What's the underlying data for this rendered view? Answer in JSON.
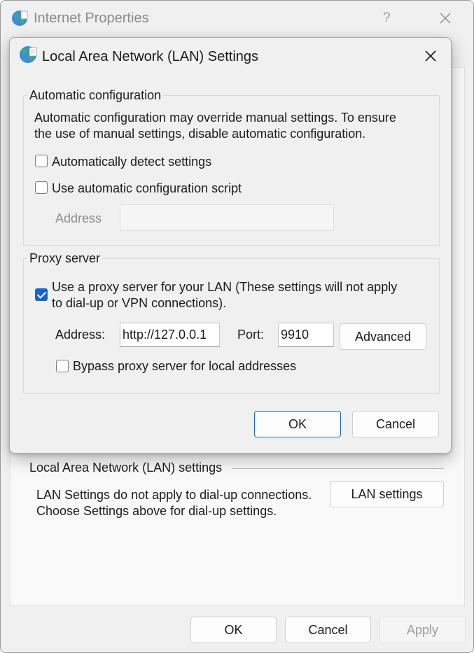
{
  "parent_window": {
    "title": "Internet Properties",
    "help": "?",
    "lan_group_title": "Local Area Network (LAN) settings",
    "lan_description": "LAN Settings do not apply to dial-up connections. Choose Settings above for dial-up settings.",
    "lan_settings_button": "LAN settings",
    "buttons": {
      "ok": "OK",
      "cancel": "Cancel",
      "apply": "Apply"
    }
  },
  "dialog": {
    "title": "Local Area Network (LAN) Settings",
    "auto_config": {
      "label": "Automatic configuration",
      "description_line1": "Automatic configuration may override manual settings.  To ensure",
      "description_line2": "the use of manual settings, disable automatic configuration.",
      "detect_settings_label": "Automatically detect settings",
      "detect_settings_checked": false,
      "script_label": "Use automatic configuration script",
      "script_checked": false,
      "address_label": "Address",
      "address_value": ""
    },
    "proxy": {
      "label": "Proxy server",
      "use_proxy_line1": "Use a proxy server for your LAN (These settings will not apply",
      "use_proxy_line2": "to dial-up or VPN connections).",
      "use_proxy_checked": true,
      "address_label": "Address:",
      "address_value": "http://127.0.0.1",
      "port_label": "Port:",
      "port_value": "9910",
      "advanced_button": "Advanced",
      "bypass_label": "Bypass proxy server for local addresses",
      "bypass_checked": false
    },
    "buttons": {
      "ok": "OK",
      "cancel": "Cancel"
    }
  },
  "colors": {
    "accent": "#1666c5",
    "window_bg": "#f0f0f0"
  }
}
